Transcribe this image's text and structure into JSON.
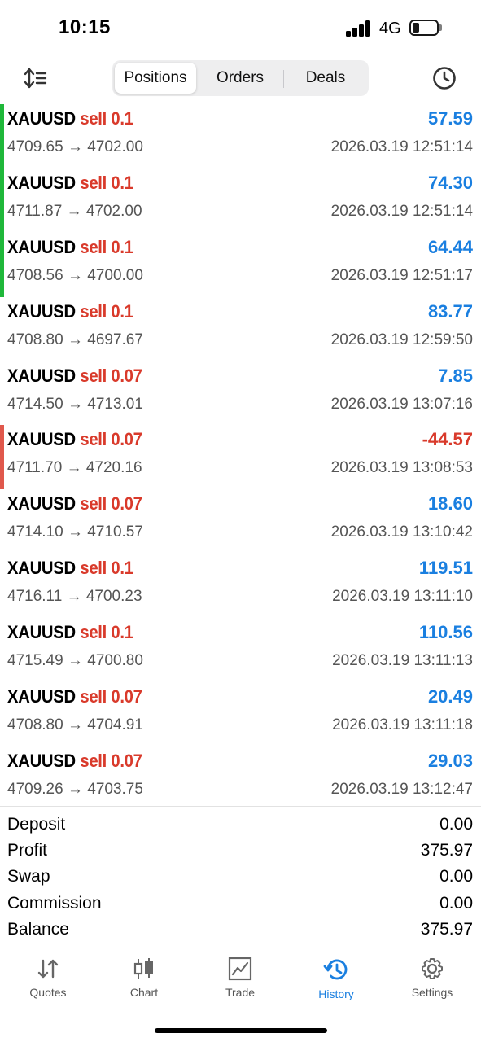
{
  "status_bar": {
    "time": "10:15",
    "network": "4G"
  },
  "header": {
    "tabs": [
      {
        "label": "Positions",
        "active": true
      },
      {
        "label": "Orders",
        "active": false
      },
      {
        "label": "Deals",
        "active": false
      }
    ]
  },
  "colors": {
    "profit_positive": "#1a7fe0",
    "profit_negative": "#d93a2b",
    "sell": "#d93a2b",
    "bar_green": "#1fb83a",
    "bar_red": "#e0584c",
    "accent": "#1a7fe0"
  },
  "positions": [
    {
      "symbol": "XAUUSD",
      "side": "sell 0.1",
      "open": "4709.65",
      "close": "4702.00",
      "time": "2026.03.19 12:51:14",
      "profit": "57.59",
      "indicator": "green"
    },
    {
      "symbol": "XAUUSD",
      "side": "sell 0.1",
      "open": "4711.87",
      "close": "4702.00",
      "time": "2026.03.19 12:51:14",
      "profit": "74.30",
      "indicator": "green"
    },
    {
      "symbol": "XAUUSD",
      "side": "sell 0.1",
      "open": "4708.56",
      "close": "4700.00",
      "time": "2026.03.19 12:51:17",
      "profit": "64.44",
      "indicator": "green"
    },
    {
      "symbol": "XAUUSD",
      "side": "sell 0.1",
      "open": "4708.80",
      "close": "4697.67",
      "time": "2026.03.19 12:59:50",
      "profit": "83.77",
      "indicator": "none"
    },
    {
      "symbol": "XAUUSD",
      "side": "sell 0.07",
      "open": "4714.50",
      "close": "4713.01",
      "time": "2026.03.19 13:07:16",
      "profit": "7.85",
      "indicator": "none"
    },
    {
      "symbol": "XAUUSD",
      "side": "sell 0.07",
      "open": "4711.70",
      "close": "4720.16",
      "time": "2026.03.19 13:08:53",
      "profit": "-44.57",
      "indicator": "red"
    },
    {
      "symbol": "XAUUSD",
      "side": "sell 0.07",
      "open": "4714.10",
      "close": "4710.57",
      "time": "2026.03.19 13:10:42",
      "profit": "18.60",
      "indicator": "none"
    },
    {
      "symbol": "XAUUSD",
      "side": "sell 0.1",
      "open": "4716.11",
      "close": "4700.23",
      "time": "2026.03.19 13:11:10",
      "profit": "119.51",
      "indicator": "none"
    },
    {
      "symbol": "XAUUSD",
      "side": "sell 0.1",
      "open": "4715.49",
      "close": "4700.80",
      "time": "2026.03.19 13:11:13",
      "profit": "110.56",
      "indicator": "none"
    },
    {
      "symbol": "XAUUSD",
      "side": "sell 0.07",
      "open": "4708.80",
      "close": "4704.91",
      "time": "2026.03.19 13:11:18",
      "profit": "20.49",
      "indicator": "none"
    },
    {
      "symbol": "XAUUSD",
      "side": "sell 0.07",
      "open": "4709.26",
      "close": "4703.75",
      "time": "2026.03.19 13:12:47",
      "profit": "29.03",
      "indicator": "none"
    }
  ],
  "summary": [
    {
      "label": "Deposit",
      "value": "0.00"
    },
    {
      "label": "Profit",
      "value": "375.97"
    },
    {
      "label": "Swap",
      "value": "0.00"
    },
    {
      "label": "Commission",
      "value": "0.00"
    },
    {
      "label": "Balance",
      "value": "375.97"
    }
  ],
  "tabbar": {
    "items": [
      {
        "label": "Quotes",
        "icon": "quotes-arrows-icon",
        "active": false
      },
      {
        "label": "Chart",
        "icon": "candlestick-icon",
        "active": false
      },
      {
        "label": "Trade",
        "icon": "trade-chart-icon",
        "active": false
      },
      {
        "label": "History",
        "icon": "history-icon",
        "active": true
      },
      {
        "label": "Settings",
        "icon": "gear-icon",
        "active": false
      }
    ]
  },
  "arrow": "→"
}
